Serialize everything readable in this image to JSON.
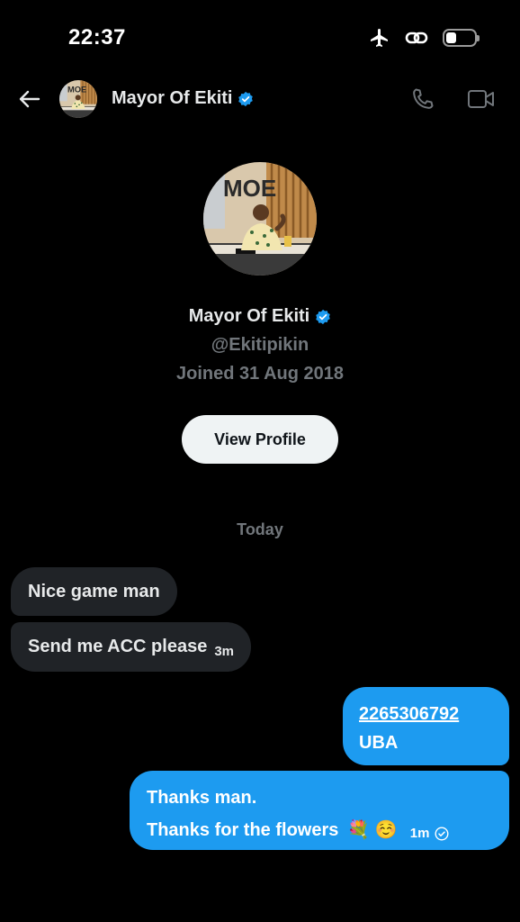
{
  "status_bar": {
    "time": "22:37",
    "icons": [
      "airplane-icon",
      "link-icon",
      "battery-icon"
    ]
  },
  "header": {
    "name": "Mayor Of Ekiti",
    "verified_color": "#1d9bf0",
    "icons": [
      "back-arrow-icon",
      "phone-icon",
      "video-icon"
    ]
  },
  "avatar": {
    "logo_text": "MOE"
  },
  "profile": {
    "name": "Mayor Of Ekiti",
    "handle": "@Ekitipikin",
    "joined": "Joined 31 Aug 2018",
    "view_profile_label": "View Profile"
  },
  "conversation": {
    "date_label": "Today",
    "incoming": [
      {
        "text": "Nice game man",
        "time": ""
      },
      {
        "text": "Send me ACC please",
        "time": "3m"
      }
    ],
    "outgoing": [
      {
        "account_number": "2265306792",
        "bank": "UBA"
      },
      {
        "line1": "Thanks man.",
        "line2": "Thanks for the flowers",
        "emojis": "💐 ☺️",
        "time": "1m",
        "status_icon": "sent-check-icon"
      }
    ]
  },
  "colors": {
    "background": "#000000",
    "accent": "#1d9bf0",
    "incoming_bubble": "#202327",
    "muted_text": "#71767b"
  }
}
